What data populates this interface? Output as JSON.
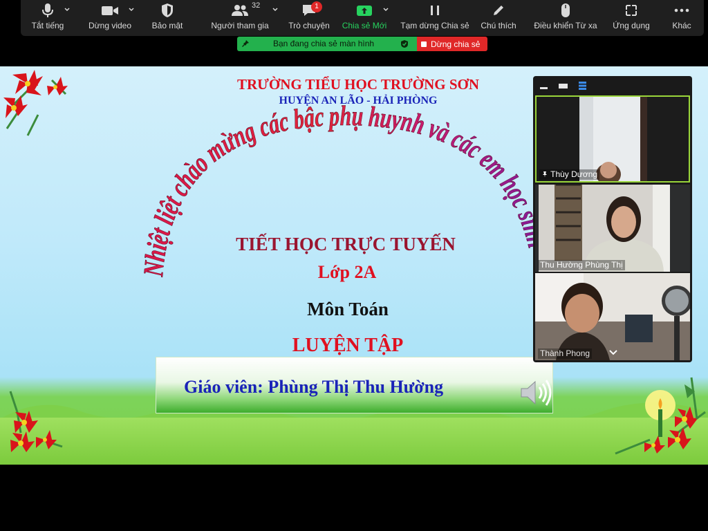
{
  "toolbar": {
    "items": [
      {
        "label": "Tắt tiếng",
        "icon": "microphone-icon"
      },
      {
        "label": "Dừng video",
        "icon": "video-camera-icon"
      },
      {
        "label": "Bảo mật",
        "icon": "shield-icon"
      },
      {
        "label": "Người tham gia",
        "icon": "participants-icon",
        "count": "32"
      },
      {
        "label": "Trò chuyện",
        "icon": "chat-icon",
        "badge": "1"
      },
      {
        "label": "Chia sẻ Mới",
        "icon": "share-screen-icon"
      },
      {
        "label": "Tạm dừng Chia sẻ",
        "icon": "pause-icon"
      },
      {
        "label": "Chú thích",
        "icon": "pencil-icon"
      },
      {
        "label": "Điều khiển Từ xa",
        "icon": "mouse-icon"
      },
      {
        "label": "Ứng dụng",
        "icon": "apps-icon"
      },
      {
        "label": "Khác",
        "icon": "more-icon"
      }
    ]
  },
  "share_status": {
    "text": "Bạn đang chia sẻ màn hình",
    "stop_label": "Dừng chia sẻ"
  },
  "slide": {
    "school": "TRƯỜNG TIỂU HỌC TRƯỜNG SƠN",
    "district": "HUYỆN AN LÃO - HẢI PHÒNG",
    "greeting": "Nhiệt liệt chào mừng các bậc phụ huynh và các em học sinh",
    "lesson_type": "TIẾT HỌC TRỰC TUYẾN",
    "class_name": "Lớp 2A",
    "subject": "Môn Toán",
    "topic": "LUYỆN TẬP",
    "teacher": "Giáo viên: Phùng Thị Thu Hường"
  },
  "video_panel": {
    "participants": [
      {
        "name": "Thùy Dương",
        "pinned": true
      },
      {
        "name": "Thu Hường Phùng Thị",
        "pinned": false
      },
      {
        "name": "Thành Phong",
        "pinned": false
      }
    ]
  },
  "colors": {
    "toolbar_bg": "#1f1f1f",
    "share_green": "#23b14d",
    "stop_red": "#e02828",
    "title_red": "#e01020",
    "title_blue": "#1a23b8"
  }
}
